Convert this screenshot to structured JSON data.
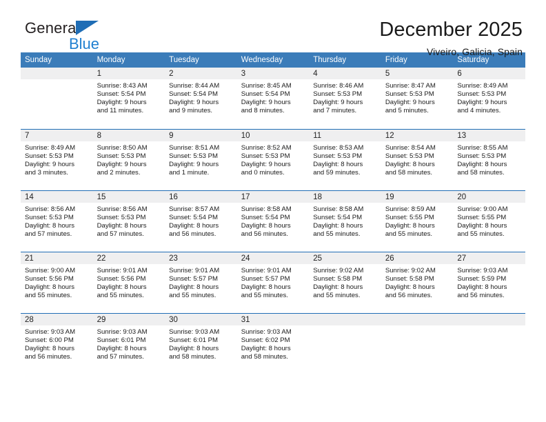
{
  "brand": {
    "name_part1": "General",
    "name_part2": "Blue",
    "triangle_icon": "triangle-icon",
    "accent_color": "#1f7fd0"
  },
  "header": {
    "title": "December 2025",
    "subtitle": "Viveiro, Galicia, Spain"
  },
  "calendar": {
    "header_bg": "#3b7cb9",
    "header_text_color": "#ffffff",
    "separator_color": "#1f6db5",
    "daynum_band_color": "#efeff0",
    "weekday_headers": [
      "Sunday",
      "Monday",
      "Tuesday",
      "Wednesday",
      "Thursday",
      "Friday",
      "Saturday"
    ],
    "weeks": [
      [
        {
          "day": "",
          "lines": []
        },
        {
          "day": "1",
          "lines": [
            "Sunrise: 8:43 AM",
            "Sunset: 5:54 PM",
            "Daylight: 9 hours",
            "and 11 minutes."
          ]
        },
        {
          "day": "2",
          "lines": [
            "Sunrise: 8:44 AM",
            "Sunset: 5:54 PM",
            "Daylight: 9 hours",
            "and 9 minutes."
          ]
        },
        {
          "day": "3",
          "lines": [
            "Sunrise: 8:45 AM",
            "Sunset: 5:54 PM",
            "Daylight: 9 hours",
            "and 8 minutes."
          ]
        },
        {
          "day": "4",
          "lines": [
            "Sunrise: 8:46 AM",
            "Sunset: 5:53 PM",
            "Daylight: 9 hours",
            "and 7 minutes."
          ]
        },
        {
          "day": "5",
          "lines": [
            "Sunrise: 8:47 AM",
            "Sunset: 5:53 PM",
            "Daylight: 9 hours",
            "and 5 minutes."
          ]
        },
        {
          "day": "6",
          "lines": [
            "Sunrise: 8:49 AM",
            "Sunset: 5:53 PM",
            "Daylight: 9 hours",
            "and 4 minutes."
          ]
        }
      ],
      [
        {
          "day": "7",
          "lines": [
            "Sunrise: 8:49 AM",
            "Sunset: 5:53 PM",
            "Daylight: 9 hours",
            "and 3 minutes."
          ]
        },
        {
          "day": "8",
          "lines": [
            "Sunrise: 8:50 AM",
            "Sunset: 5:53 PM",
            "Daylight: 9 hours",
            "and 2 minutes."
          ]
        },
        {
          "day": "9",
          "lines": [
            "Sunrise: 8:51 AM",
            "Sunset: 5:53 PM",
            "Daylight: 9 hours",
            "and 1 minute."
          ]
        },
        {
          "day": "10",
          "lines": [
            "Sunrise: 8:52 AM",
            "Sunset: 5:53 PM",
            "Daylight: 9 hours",
            "and 0 minutes."
          ]
        },
        {
          "day": "11",
          "lines": [
            "Sunrise: 8:53 AM",
            "Sunset: 5:53 PM",
            "Daylight: 8 hours",
            "and 59 minutes."
          ]
        },
        {
          "day": "12",
          "lines": [
            "Sunrise: 8:54 AM",
            "Sunset: 5:53 PM",
            "Daylight: 8 hours",
            "and 58 minutes."
          ]
        },
        {
          "day": "13",
          "lines": [
            "Sunrise: 8:55 AM",
            "Sunset: 5:53 PM",
            "Daylight: 8 hours",
            "and 58 minutes."
          ]
        }
      ],
      [
        {
          "day": "14",
          "lines": [
            "Sunrise: 8:56 AM",
            "Sunset: 5:53 PM",
            "Daylight: 8 hours",
            "and 57 minutes."
          ]
        },
        {
          "day": "15",
          "lines": [
            "Sunrise: 8:56 AM",
            "Sunset: 5:53 PM",
            "Daylight: 8 hours",
            "and 57 minutes."
          ]
        },
        {
          "day": "16",
          "lines": [
            "Sunrise: 8:57 AM",
            "Sunset: 5:54 PM",
            "Daylight: 8 hours",
            "and 56 minutes."
          ]
        },
        {
          "day": "17",
          "lines": [
            "Sunrise: 8:58 AM",
            "Sunset: 5:54 PM",
            "Daylight: 8 hours",
            "and 56 minutes."
          ]
        },
        {
          "day": "18",
          "lines": [
            "Sunrise: 8:58 AM",
            "Sunset: 5:54 PM",
            "Daylight: 8 hours",
            "and 55 minutes."
          ]
        },
        {
          "day": "19",
          "lines": [
            "Sunrise: 8:59 AM",
            "Sunset: 5:55 PM",
            "Daylight: 8 hours",
            "and 55 minutes."
          ]
        },
        {
          "day": "20",
          "lines": [
            "Sunrise: 9:00 AM",
            "Sunset: 5:55 PM",
            "Daylight: 8 hours",
            "and 55 minutes."
          ]
        }
      ],
      [
        {
          "day": "21",
          "lines": [
            "Sunrise: 9:00 AM",
            "Sunset: 5:56 PM",
            "Daylight: 8 hours",
            "and 55 minutes."
          ]
        },
        {
          "day": "22",
          "lines": [
            "Sunrise: 9:01 AM",
            "Sunset: 5:56 PM",
            "Daylight: 8 hours",
            "and 55 minutes."
          ]
        },
        {
          "day": "23",
          "lines": [
            "Sunrise: 9:01 AM",
            "Sunset: 5:57 PM",
            "Daylight: 8 hours",
            "and 55 minutes."
          ]
        },
        {
          "day": "24",
          "lines": [
            "Sunrise: 9:01 AM",
            "Sunset: 5:57 PM",
            "Daylight: 8 hours",
            "and 55 minutes."
          ]
        },
        {
          "day": "25",
          "lines": [
            "Sunrise: 9:02 AM",
            "Sunset: 5:58 PM",
            "Daylight: 8 hours",
            "and 55 minutes."
          ]
        },
        {
          "day": "26",
          "lines": [
            "Sunrise: 9:02 AM",
            "Sunset: 5:58 PM",
            "Daylight: 8 hours",
            "and 56 minutes."
          ]
        },
        {
          "day": "27",
          "lines": [
            "Sunrise: 9:03 AM",
            "Sunset: 5:59 PM",
            "Daylight: 8 hours",
            "and 56 minutes."
          ]
        }
      ],
      [
        {
          "day": "28",
          "lines": [
            "Sunrise: 9:03 AM",
            "Sunset: 6:00 PM",
            "Daylight: 8 hours",
            "and 56 minutes."
          ]
        },
        {
          "day": "29",
          "lines": [
            "Sunrise: 9:03 AM",
            "Sunset: 6:01 PM",
            "Daylight: 8 hours",
            "and 57 minutes."
          ]
        },
        {
          "day": "30",
          "lines": [
            "Sunrise: 9:03 AM",
            "Sunset: 6:01 PM",
            "Daylight: 8 hours",
            "and 58 minutes."
          ]
        },
        {
          "day": "31",
          "lines": [
            "Sunrise: 9:03 AM",
            "Sunset: 6:02 PM",
            "Daylight: 8 hours",
            "and 58 minutes."
          ]
        },
        {
          "day": "",
          "lines": []
        },
        {
          "day": "",
          "lines": []
        },
        {
          "day": "",
          "lines": []
        }
      ]
    ]
  }
}
